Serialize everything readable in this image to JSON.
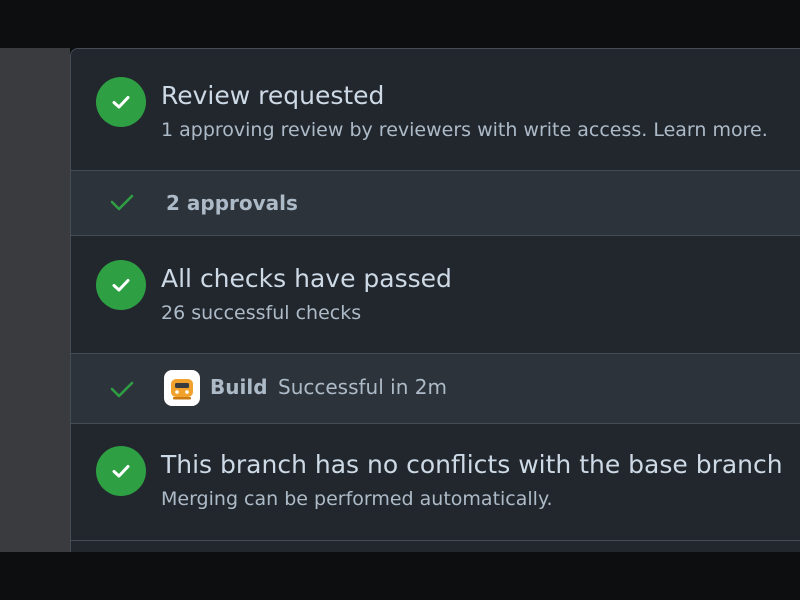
{
  "checks": {
    "review": {
      "title": "Review requested",
      "description": "1 approving review by reviewers with write access. Learn more."
    },
    "approvals": {
      "label": "2 approvals"
    },
    "all_checks": {
      "title": "All checks have passed",
      "description": "26 successful checks"
    },
    "build": {
      "name": "Build",
      "status": "Successful in 2m",
      "icon": "build-app-icon"
    },
    "conflicts": {
      "title": "This branch has no conflicts with the base branch",
      "description": "Merging can be performed automatically."
    }
  },
  "colors": {
    "success": "#2ea043",
    "panel_background": "#22272e",
    "sub_row_background": "#2d333b",
    "border": "#444c56",
    "text_primary": "#cdd9e5",
    "text_secondary": "#adbac7"
  }
}
